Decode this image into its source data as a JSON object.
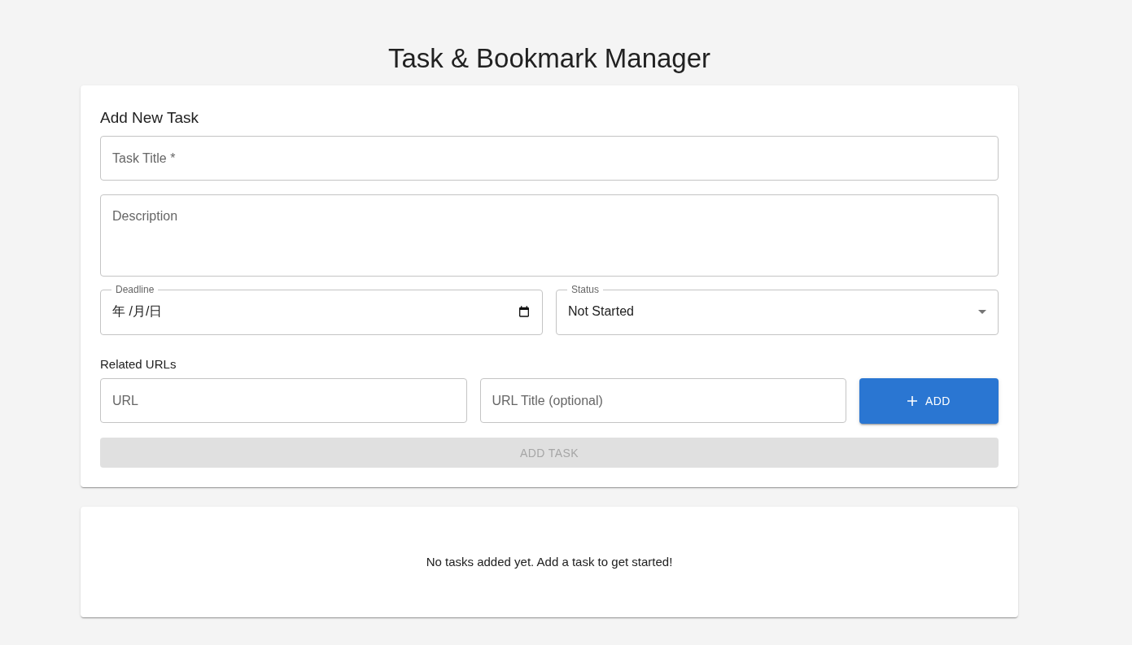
{
  "title": "Task & Bookmark Manager",
  "form": {
    "heading": "Add New Task",
    "task_title": {
      "placeholder": "Task Title *"
    },
    "description": {
      "placeholder": "Description"
    },
    "deadline": {
      "label": "Deadline",
      "value": "年 /月/日"
    },
    "status": {
      "label": "Status",
      "value": "Not Started"
    },
    "urls_label": "Related URLs",
    "url": {
      "placeholder": "URL"
    },
    "url_title": {
      "placeholder": "URL Title (optional)"
    },
    "add_url_button": "ADD",
    "submit": {
      "label": "ADD TASK",
      "disabled": true
    }
  },
  "empty_message": "No tasks added yet. Add a task to get started!"
}
